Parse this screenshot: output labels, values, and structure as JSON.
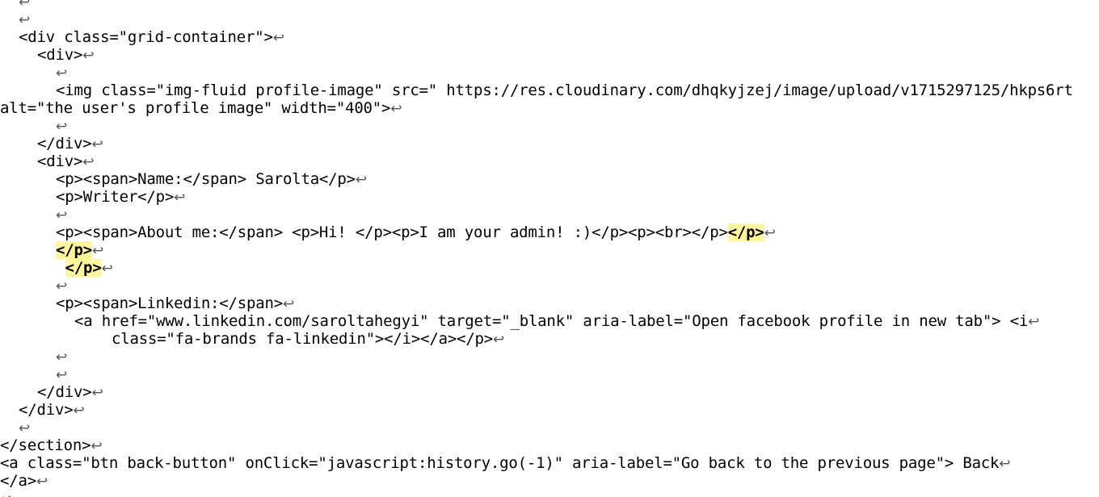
{
  "document": {
    "return_symbol": "↩",
    "highlight_color": "#fff59a",
    "lines": [
      {
        "indent": 2,
        "text": ""
      },
      {
        "indent": 2,
        "text": ""
      },
      {
        "indent": 2,
        "text": "<div class=\"grid-container\">"
      },
      {
        "indent": 4,
        "text": "<div>"
      },
      {
        "indent": 6,
        "text": ""
      },
      {
        "indent": 6,
        "text": "<img class=\"img-fluid profile-image\" src=\" https://res.cloudinary.com/dhqkyjzej/image/upload/v1715297125/hkps6rt",
        "no_return": true
      },
      {
        "indent": 0,
        "text": "alt=\"the user's profile image\" width=\"400\">"
      },
      {
        "indent": 6,
        "text": ""
      },
      {
        "indent": 4,
        "text": "</div>"
      },
      {
        "indent": 4,
        "text": "<div>"
      },
      {
        "indent": 6,
        "text": "<p><span>Name:</span> Sarolta</p>"
      },
      {
        "indent": 6,
        "text": "<p>Writer</p>"
      },
      {
        "indent": 6,
        "text": ""
      },
      {
        "indent": 6,
        "text": "<p><span>About me:</span> <p>Hi! </p><p>I am your admin! :)</p><p><br></p>",
        "highlight": "</p>"
      },
      {
        "indent": 6,
        "text": "",
        "highlight": "</p>"
      },
      {
        "indent": 7,
        "text": "",
        "highlight": "</p>"
      },
      {
        "indent": 6,
        "text": ""
      },
      {
        "indent": 6,
        "text": "<p><span>Linkedin:</span>"
      },
      {
        "indent": 8,
        "text": "<a href=\"www.linkedin.com/saroltahegyi\" target=\"_blank\" aria-label=\"Open facebook profile in new tab\"> <i"
      },
      {
        "indent": 12,
        "text": "class=\"fa-brands fa-linkedin\"></i></a></p>"
      },
      {
        "indent": 6,
        "text": ""
      },
      {
        "indent": 6,
        "text": ""
      },
      {
        "indent": 4,
        "text": "</div>"
      },
      {
        "indent": 2,
        "text": "</div>"
      },
      {
        "indent": 2,
        "text": ""
      },
      {
        "indent": 0,
        "text": "</section>"
      },
      {
        "indent": 0,
        "text": "<a class=\"btn back-button\" onClick=\"javascript:history.go(-1)\" aria-label=\"Go back to the previous page\"> Back"
      },
      {
        "indent": 0,
        "text": "</a>"
      },
      {
        "indent": 0,
        "text": ""
      }
    ]
  }
}
